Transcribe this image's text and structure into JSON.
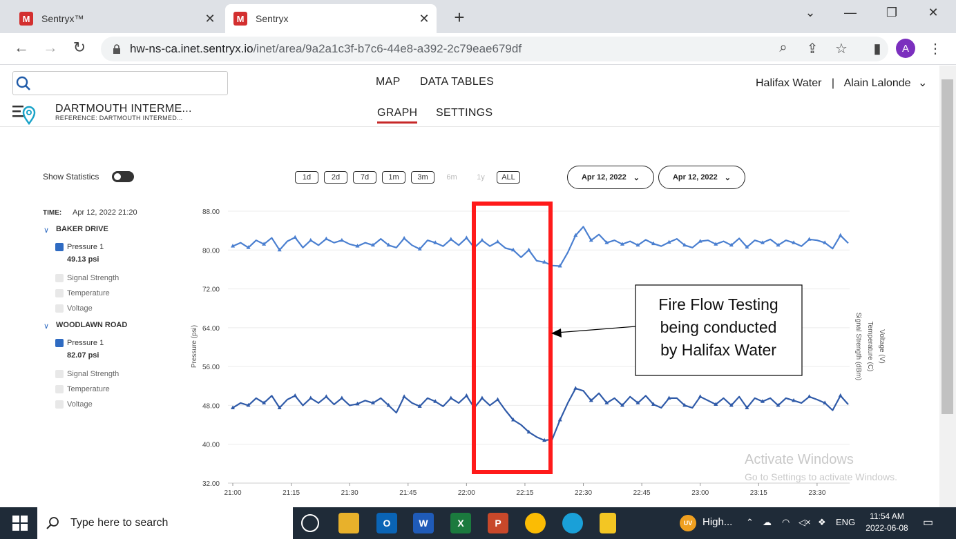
{
  "browser": {
    "tabs": [
      {
        "title": "Sentryx™",
        "favicon": "M"
      },
      {
        "title": "Sentryx",
        "favicon": "M"
      }
    ],
    "url_host": "hw-ns-ca.inet.sentryx.io",
    "url_path": "/inet/area/9a2a1c3f-b7c6-44e8-a392-2c79eae679df",
    "profile_initial": "A"
  },
  "header": {
    "nav": [
      "MAP",
      "DATA TABLES"
    ],
    "subnav": [
      "GRAPH",
      "SETTINGS"
    ],
    "org": "Halifax Water",
    "user": "Alain Lalonde",
    "area_title": "DARTMOUTH INTERME...",
    "area_ref": "REFERENCE: DARTMOUTH INTERMED..."
  },
  "controls": {
    "show_statistics": "Show Statistics",
    "ranges": [
      "1d",
      "2d",
      "7d",
      "1m",
      "3m",
      "6m",
      "1y",
      "ALL"
    ],
    "date_from": "Apr 12, 2022",
    "date_to": "Apr 12, 2022"
  },
  "legend": {
    "time_label": "TIME:",
    "time_value": "Apr 12, 2022 21:20",
    "groups": [
      {
        "name": "BAKER DRIVE",
        "pressure_label": "Pressure 1",
        "pressure_value": "49.13 psi",
        "others": [
          "Signal Strength",
          "Temperature",
          "Voltage"
        ]
      },
      {
        "name": "WOODLAWN ROAD",
        "pressure_label": "Pressure 1",
        "pressure_value": "82.07 psi",
        "others": [
          "Signal Strength",
          "Temperature",
          "Voltage"
        ]
      }
    ]
  },
  "chart_data": {
    "type": "line",
    "ylabel": "Pressure (psi)",
    "right_axis_labels": [
      "Signal Strength (dBm)",
      "Temperature (C)",
      "Voltage (V)"
    ],
    "ylim": [
      32,
      88
    ],
    "yticks": [
      "88.00",
      "80.00",
      "72.00",
      "64.00",
      "56.00",
      "48.00",
      "40.00",
      "32.00"
    ],
    "xticks": [
      "21:00",
      "21:15",
      "21:30",
      "21:45",
      "22:00",
      "22:15",
      "22:30",
      "22:45",
      "23:00",
      "23:15",
      "23:30"
    ],
    "xrange_minutes": [
      0,
      158
    ],
    "series": [
      {
        "color": "#4a7fd0",
        "points": [
          [
            0,
            80.8
          ],
          [
            2,
            81.5
          ],
          [
            4,
            80.5
          ],
          [
            6,
            82.0
          ],
          [
            8,
            81.2
          ],
          [
            10,
            82.5
          ],
          [
            12,
            80.0
          ],
          [
            14,
            81.8
          ],
          [
            16,
            82.6
          ],
          [
            18,
            80.5
          ],
          [
            20,
            82.0
          ],
          [
            22,
            81.0
          ],
          [
            24,
            82.3
          ],
          [
            26,
            81.5
          ],
          [
            28,
            82.0
          ],
          [
            30,
            81.2
          ],
          [
            32,
            80.8
          ],
          [
            34,
            81.5
          ],
          [
            36,
            81.0
          ],
          [
            38,
            82.3
          ],
          [
            40,
            81.0
          ],
          [
            42,
            80.5
          ],
          [
            44,
            82.4
          ],
          [
            46,
            81.0
          ],
          [
            48,
            80.2
          ],
          [
            50,
            82.0
          ],
          [
            52,
            81.5
          ],
          [
            54,
            80.8
          ],
          [
            56,
            82.2
          ],
          [
            58,
            81.0
          ],
          [
            60,
            82.5
          ],
          [
            62,
            80.5
          ],
          [
            64,
            82.0
          ],
          [
            66,
            80.8
          ],
          [
            68,
            81.7
          ],
          [
            70,
            80.4
          ],
          [
            72,
            80.0
          ],
          [
            74,
            78.5
          ],
          [
            76,
            80.0
          ],
          [
            78,
            77.8
          ],
          [
            80,
            77.5
          ],
          [
            82,
            76.8
          ],
          [
            84,
            76.7
          ],
          [
            86,
            79.5
          ],
          [
            88,
            83.0
          ],
          [
            90,
            84.8
          ],
          [
            92,
            82.0
          ],
          [
            94,
            83.2
          ],
          [
            96,
            81.5
          ],
          [
            98,
            82.0
          ],
          [
            100,
            81.2
          ],
          [
            102,
            81.8
          ],
          [
            104,
            81.0
          ],
          [
            106,
            82.1
          ],
          [
            108,
            81.3
          ],
          [
            110,
            80.8
          ],
          [
            112,
            81.6
          ],
          [
            114,
            82.3
          ],
          [
            116,
            81.0
          ],
          [
            118,
            80.5
          ],
          [
            120,
            81.8
          ],
          [
            122,
            82.0
          ],
          [
            124,
            81.2
          ],
          [
            126,
            81.8
          ],
          [
            128,
            81.0
          ],
          [
            130,
            82.4
          ],
          [
            132,
            80.6
          ],
          [
            134,
            82.0
          ],
          [
            136,
            81.5
          ],
          [
            138,
            82.2
          ],
          [
            140,
            81.0
          ],
          [
            142,
            82.0
          ],
          [
            144,
            81.5
          ],
          [
            146,
            80.8
          ],
          [
            148,
            82.2
          ],
          [
            150,
            82.0
          ],
          [
            152,
            81.5
          ],
          [
            154,
            80.3
          ],
          [
            156,
            83.0
          ],
          [
            158,
            81.4
          ]
        ]
      },
      {
        "color": "#2f5aa8",
        "points": [
          [
            0,
            47.5
          ],
          [
            2,
            48.5
          ],
          [
            4,
            48.0
          ],
          [
            6,
            49.5
          ],
          [
            8,
            48.5
          ],
          [
            10,
            50.0
          ],
          [
            12,
            47.5
          ],
          [
            14,
            49.2
          ],
          [
            16,
            50.0
          ],
          [
            18,
            48.0
          ],
          [
            20,
            49.5
          ],
          [
            22,
            48.5
          ],
          [
            24,
            49.8
          ],
          [
            26,
            48.2
          ],
          [
            28,
            49.5
          ],
          [
            30,
            48.0
          ],
          [
            32,
            48.3
          ],
          [
            34,
            49.0
          ],
          [
            36,
            48.5
          ],
          [
            38,
            49.5
          ],
          [
            40,
            48.0
          ],
          [
            42,
            46.5
          ],
          [
            44,
            49.8
          ],
          [
            46,
            48.5
          ],
          [
            48,
            47.8
          ],
          [
            50,
            49.5
          ],
          [
            52,
            48.8
          ],
          [
            54,
            47.8
          ],
          [
            56,
            49.5
          ],
          [
            58,
            48.5
          ],
          [
            60,
            50.0
          ],
          [
            62,
            47.5
          ],
          [
            64,
            49.5
          ],
          [
            66,
            48.0
          ],
          [
            68,
            49.2
          ],
          [
            70,
            47.0
          ],
          [
            72,
            45.0
          ],
          [
            74,
            44.0
          ],
          [
            76,
            42.5
          ],
          [
            78,
            41.5
          ],
          [
            80,
            40.8
          ],
          [
            82,
            41.0
          ],
          [
            84,
            45.0
          ],
          [
            86,
            48.5
          ],
          [
            88,
            51.5
          ],
          [
            90,
            51.0
          ],
          [
            92,
            49.0
          ],
          [
            94,
            50.5
          ],
          [
            96,
            48.5
          ],
          [
            98,
            49.5
          ],
          [
            100,
            48.0
          ],
          [
            102,
            49.8
          ],
          [
            104,
            48.5
          ],
          [
            106,
            50.0
          ],
          [
            108,
            48.2
          ],
          [
            110,
            47.5
          ],
          [
            112,
            49.5
          ],
          [
            114,
            49.5
          ],
          [
            116,
            48.0
          ],
          [
            118,
            47.5
          ],
          [
            120,
            49.8
          ],
          [
            122,
            49.0
          ],
          [
            124,
            48.2
          ],
          [
            126,
            49.5
          ],
          [
            128,
            48.0
          ],
          [
            130,
            49.8
          ],
          [
            132,
            47.5
          ],
          [
            134,
            49.5
          ],
          [
            136,
            48.8
          ],
          [
            138,
            49.5
          ],
          [
            140,
            48.0
          ],
          [
            142,
            49.5
          ],
          [
            144,
            49.0
          ],
          [
            146,
            48.5
          ],
          [
            148,
            49.8
          ],
          [
            150,
            49.2
          ],
          [
            152,
            48.5
          ],
          [
            154,
            47.0
          ],
          [
            156,
            50.0
          ],
          [
            158,
            48.2
          ]
        ]
      }
    ],
    "annotation": "Fire Flow Testing being conducted by Halifax Water"
  },
  "watermark": {
    "line1": "Activate Windows",
    "line2": "Go to Settings to activate Windows."
  },
  "taskbar": {
    "search_placeholder": "Type here to search",
    "weather_text": "High...",
    "lang": "ENG",
    "time": "11:54 AM",
    "date": "2022-06-08"
  }
}
